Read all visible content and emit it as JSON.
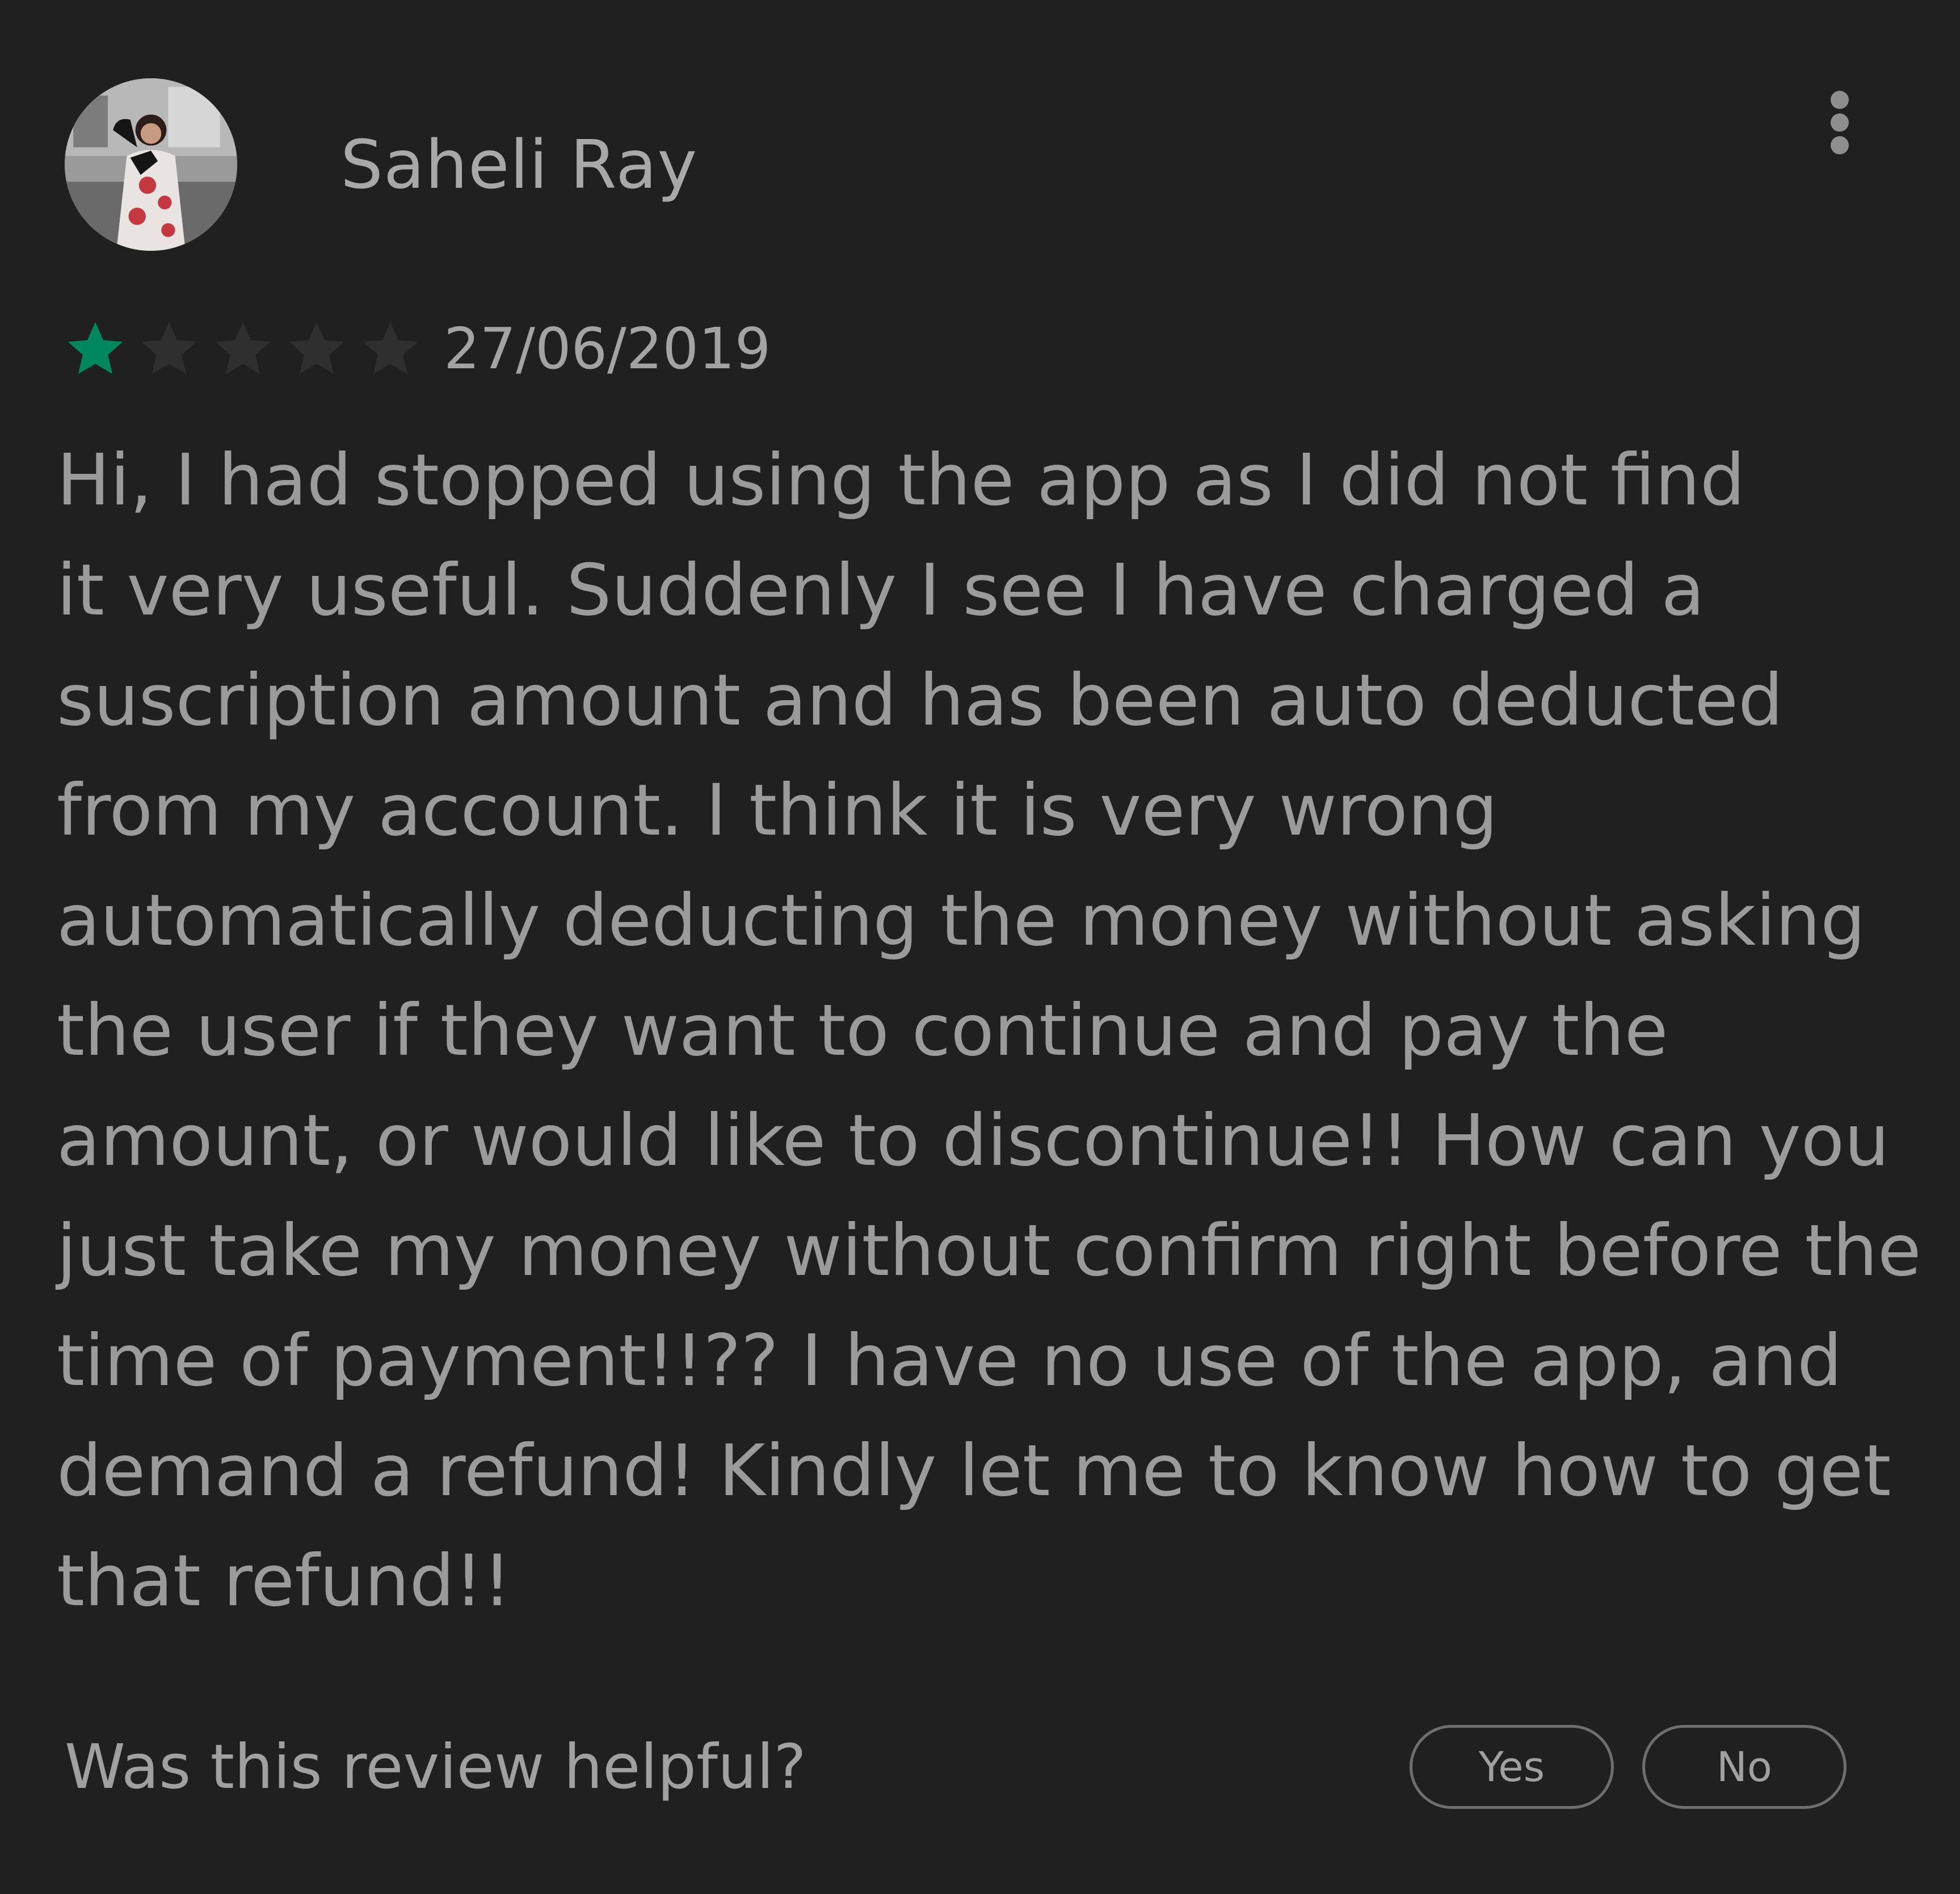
{
  "review": {
    "author": "Saheli Ray",
    "rating": 1,
    "max_rating": 5,
    "date": "27/06/2019",
    "body_lines": [
      "Hi, I had stopped using the app as I did not find",
      "it very useful. Suddenly I see I have charged a",
      "suscription amount and has been auto deducted",
      "from my account. I think it is very wrong",
      "automatically deducting the money without asking",
      "the user if they want to continue and pay the",
      "amount, or would like to discontinue!! How can you",
      "just take my money without confirm right before the",
      "time of payment!!?? I have no use of the app, and",
      "demand a refund! Kindly let me to know how to get",
      "that refund!!"
    ]
  },
  "helpful": {
    "question": "Was this review helpful?",
    "yes_label": "Yes",
    "no_label": "No"
  },
  "icons": {
    "more": "more-vert-icon",
    "star": "star-icon",
    "avatar": "user-avatar"
  },
  "colors": {
    "background": "#202020",
    "star_filled": "#01875f",
    "star_empty": "#2f2f2f",
    "text": "#9b9b9b",
    "button_border": "#6e6e6e"
  }
}
